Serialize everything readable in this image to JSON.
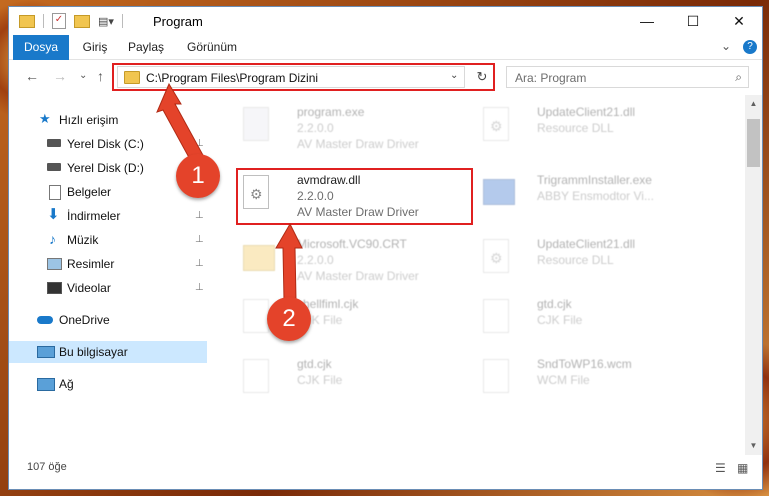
{
  "window": {
    "title": "Program",
    "controls": {
      "minimize": "—",
      "maximize": "☐",
      "close": "✕"
    }
  },
  "ribbon": {
    "tabs": [
      "Dosya",
      "Giriş",
      "Paylaş",
      "Görünüm"
    ],
    "collapse": "⌄",
    "help": "?"
  },
  "nav": {
    "back": "←",
    "forward": "→",
    "recent": "⌄",
    "up": "↑",
    "address": "C:\\Program Files\\Program Dizini",
    "address_dropdown": "⌄",
    "refresh": "↻",
    "search_placeholder": "Ara: Program",
    "search_icon": "⌕"
  },
  "sidebar": {
    "items": [
      {
        "label": "Hızlı erişim",
        "icon": "star-icon",
        "pinned": false
      },
      {
        "label": "Yerel Disk (C:)",
        "icon": "drive-icon",
        "pinned": true
      },
      {
        "label": "Yerel Disk (D:)",
        "icon": "drive-icon",
        "pinned": true
      },
      {
        "label": "Belgeler",
        "icon": "documents-icon",
        "pinned": true
      },
      {
        "label": "İndirmeler",
        "icon": "download-icon",
        "pinned": true
      },
      {
        "label": "Müzik",
        "icon": "music-icon",
        "pinned": true
      },
      {
        "label": "Resimler",
        "icon": "pictures-icon",
        "pinned": true
      },
      {
        "label": "Videolar",
        "icon": "videos-icon",
        "pinned": true
      },
      {
        "label": "OneDrive",
        "icon": "cloud-icon",
        "pinned": false
      },
      {
        "label": "Bu bilgisayar",
        "icon": "computer-icon",
        "pinned": false
      },
      {
        "label": "Ağ",
        "icon": "network-icon",
        "pinned": false
      }
    ],
    "pin_glyph": "📌"
  },
  "files": [
    {
      "name": "program.exe",
      "version": "2.2.0.0",
      "desc": "AV Master Draw Driver",
      "highlight": false
    },
    {
      "name": "UpdateClient21.dll",
      "version": "Resource DLL",
      "desc": "",
      "highlight": false
    },
    {
      "name": "avmdraw.dll",
      "version": "2.2.0.0",
      "desc": "AV Master Draw Driver",
      "highlight": true
    },
    {
      "name": "TrigrammInstaller.exe",
      "version": "ABBY Ensmodtor Vi...",
      "desc": "",
      "highlight": false
    },
    {
      "name": "Microsoft.VC90.CRT",
      "version": "2.2.0.0",
      "desc": "AV Master Draw Driver",
      "highlight": false
    },
    {
      "name": "UpdateClient21.dll",
      "version": "Resource DLL",
      "desc": "",
      "highlight": false
    },
    {
      "name": "shellfiml.cjk",
      "version": "CJK File",
      "desc": "",
      "highlight": false
    },
    {
      "name": "gtd.cjk",
      "version": "CJK File",
      "desc": "",
      "highlight": false
    },
    {
      "name": "gtd.cjk",
      "version": "CJK File",
      "desc": "",
      "highlight": false
    },
    {
      "name": "SndToWP16.wcm",
      "version": "WCM File",
      "desc": "",
      "highlight": false
    }
  ],
  "status": {
    "count": "107 öğe",
    "view_details": "☰",
    "view_tiles": "▦"
  },
  "annotations": {
    "step1": "1",
    "step2": "2"
  },
  "colors": {
    "accent": "#1979ca",
    "highlight_box": "#e02020",
    "badge": "#e4432a",
    "selected": "#cce8ff"
  }
}
